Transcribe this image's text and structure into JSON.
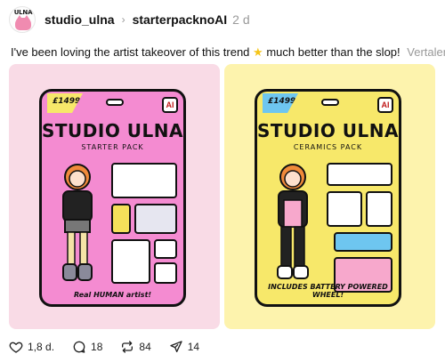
{
  "post": {
    "username": "studio_ulna",
    "topic": "starterpacknoAI",
    "time": "2 d",
    "avatar_text": "ULNA",
    "caption_before": "I've been loving the artist takeover of this trend",
    "caption_after": "much better than the slop!",
    "translate_label": "Vertalen"
  },
  "images": {
    "left": {
      "price": "£1499",
      "ai_badge": "AI",
      "title": "STUDIO ULNA",
      "subtitle": "STARTER PACK",
      "footer": "Real HUMAN artist!"
    },
    "right": {
      "price": "£1499",
      "ai_badge": "AI",
      "title": "STUDIO ULNA",
      "subtitle": "CERAMICS PACK",
      "footer": "INCLUDES BATTERY POWERED WHEEL!"
    }
  },
  "actions": {
    "likes": "1,8 d.",
    "replies": "18",
    "reposts": "84",
    "shares": "14"
  },
  "colors": {
    "left_bg": "#f9dbe6",
    "left_pack": "#f48bd1",
    "right_bg": "#fdf3ad",
    "right_pack": "#f7e86a",
    "muted": "#999999"
  }
}
